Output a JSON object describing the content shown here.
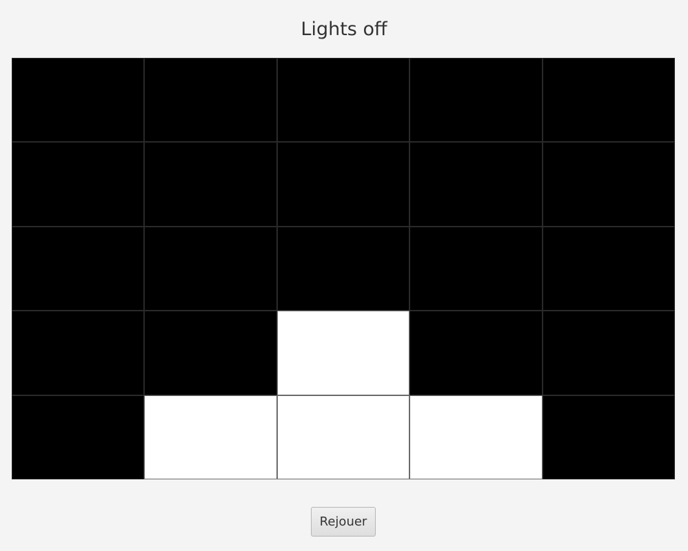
{
  "title": "Lights off",
  "board": {
    "rows": 5,
    "cols": 5,
    "cells": [
      [
        0,
        0,
        0,
        0,
        0
      ],
      [
        0,
        0,
        0,
        0,
        0
      ],
      [
        0,
        0,
        0,
        0,
        0
      ],
      [
        0,
        0,
        1,
        0,
        0
      ],
      [
        0,
        1,
        1,
        1,
        0
      ]
    ]
  },
  "colors": {
    "off": "#000000",
    "on": "#ffffff"
  },
  "replay_label": "Rejouer"
}
